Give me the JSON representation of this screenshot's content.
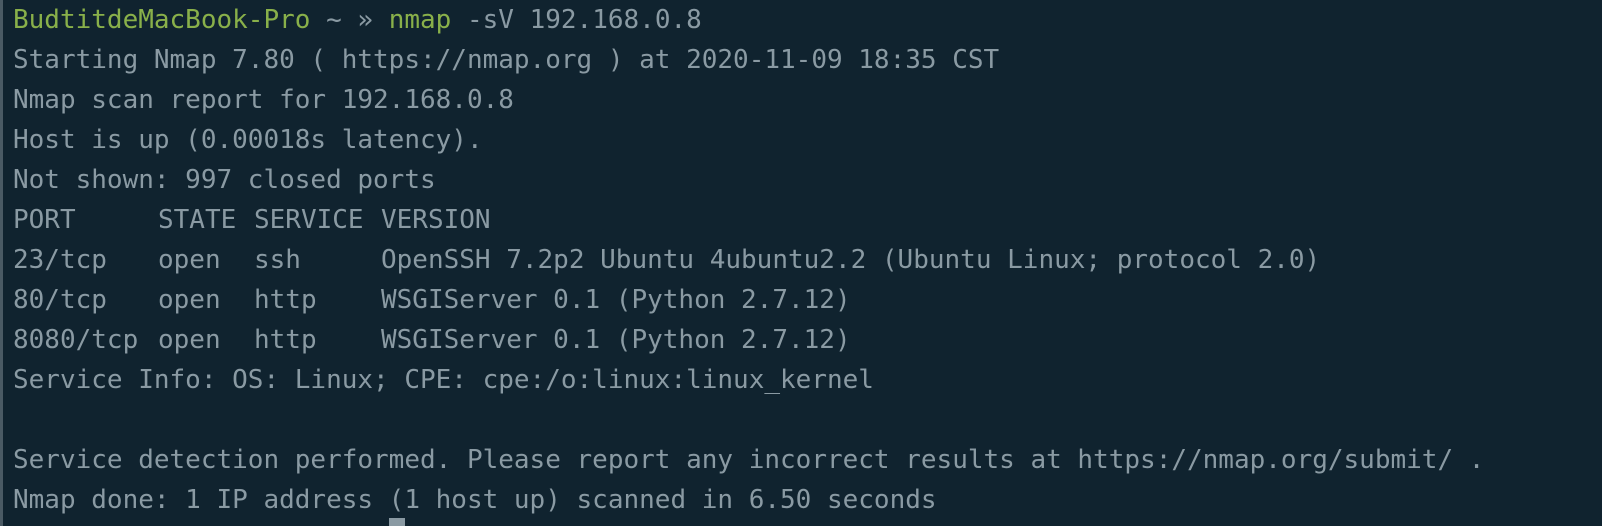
{
  "prompt": {
    "host": "BudtitdeMacBook-Pro",
    "separator": " ~ » ",
    "command": "nmap",
    "args": " -sV 192.168.0.8"
  },
  "output": {
    "starting": "Starting Nmap 7.80 ( https://nmap.org ) at 2020-11-09 18:35 CST",
    "report_for": "Nmap scan report for 192.168.0.8",
    "host_up": "Host is up (0.00018s latency).",
    "not_shown": "Not shown: 997 closed ports",
    "headers": {
      "port": "PORT",
      "state": "STATE",
      "service": "SERVICE",
      "version": "VERSION"
    },
    "ports": [
      {
        "port": "23/tcp",
        "state": "open",
        "service": "ssh",
        "version": "OpenSSH 7.2p2 Ubuntu 4ubuntu2.2 (Ubuntu Linux; protocol 2.0)"
      },
      {
        "port": "80/tcp",
        "state": "open",
        "service": "http",
        "version": "WSGIServer 0.1 (Python 2.7.12)"
      },
      {
        "port": "8080/tcp",
        "state": "open",
        "service": "http",
        "version": "WSGIServer 0.1 (Python 2.7.12)"
      }
    ],
    "service_info": "Service Info: OS: Linux; CPE: cpe:/o:linux:linux_kernel",
    "detection_note": "Service detection performed. Please report any incorrect results at https://nmap.org/submit/ .",
    "done": "Nmap done: 1 IP address (1 host up) scanned in 6.50 seconds"
  },
  "colors": {
    "background": "#10232f",
    "text": "#8a9aa3",
    "prompt": "#89b04a"
  }
}
